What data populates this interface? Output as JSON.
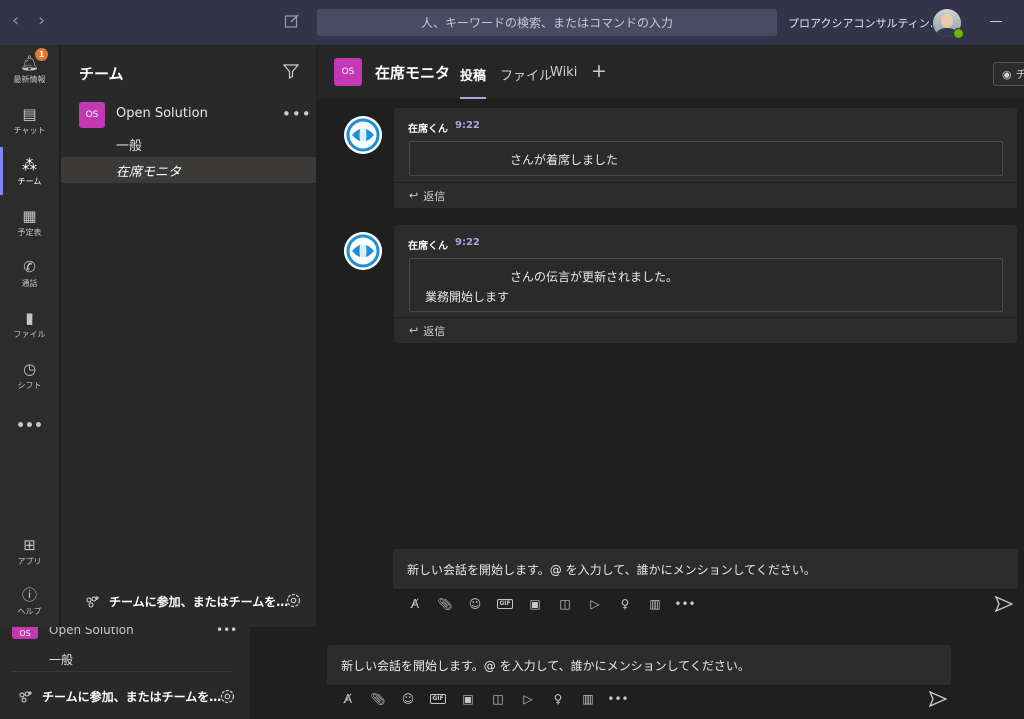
{
  "topbar": {
    "search_placeholder": "人、キーワードの検索、またはコマンドの入力",
    "org_name": "プロアクシアコンサルティン…",
    "back_icon": "chevron-left-icon",
    "forward_icon": "chevron-right-icon",
    "compose_icon": "compose-icon"
  },
  "rail": {
    "items": [
      {
        "label": "最新情報",
        "icon": "bell-icon",
        "badge": "1"
      },
      {
        "label": "チャット",
        "icon": "chat-icon"
      },
      {
        "label": "チーム",
        "icon": "teams-icon"
      },
      {
        "label": "予定表",
        "icon": "calendar-icon"
      },
      {
        "label": "通話",
        "icon": "phone-icon"
      },
      {
        "label": "ファイル",
        "icon": "file-icon"
      },
      {
        "label": "シフト",
        "icon": "shifts-icon"
      },
      {
        "label": "•••",
        "icon": "more-icon"
      },
      {
        "label": "アプリ",
        "icon": "apps-icon"
      },
      {
        "label": "ヘルプ",
        "icon": "help-icon"
      }
    ]
  },
  "teams_panel": {
    "title": "チーム",
    "team": {
      "initials": "OS",
      "name": "Open Solution",
      "more": "•••"
    },
    "channels": [
      "一般",
      "在席モニタ"
    ],
    "join_label": "チームに参加、またはチームを…"
  },
  "channel_header": {
    "initials": "OS",
    "name": "在席モニタ",
    "tabs": [
      "投稿",
      "ファイル",
      "Wiki"
    ],
    "add_tab": "+",
    "watch_label": "チ"
  },
  "messages": [
    {
      "author": "在席くん",
      "time": "9:22",
      "lines": [
        "さんが着席しました"
      ],
      "reply": "返信"
    },
    {
      "author": "在席くん",
      "time": "9:22",
      "lines": [
        "さんの伝言が更新されました。",
        "業務開始します"
      ],
      "reply": "返信"
    }
  ],
  "composer": {
    "placeholder": "新しい会話を開始します。@ を入力して、誰かにメンションしてください。"
  },
  "background_window": {
    "team": {
      "initials": "OS",
      "name": "Open Solution",
      "more": "•••"
    },
    "channel": "一般",
    "join_label": "チームに参加、またはチームを…",
    "composer_placeholder": "新しい会話を開始します。@ を入力して、誰かにメンションしてください。"
  },
  "colors": {
    "accent": "#7f85f5",
    "team_tile": "#c239b3",
    "topbar": "#33344a",
    "badge": "#e0762f",
    "presence": "#6bb700"
  }
}
